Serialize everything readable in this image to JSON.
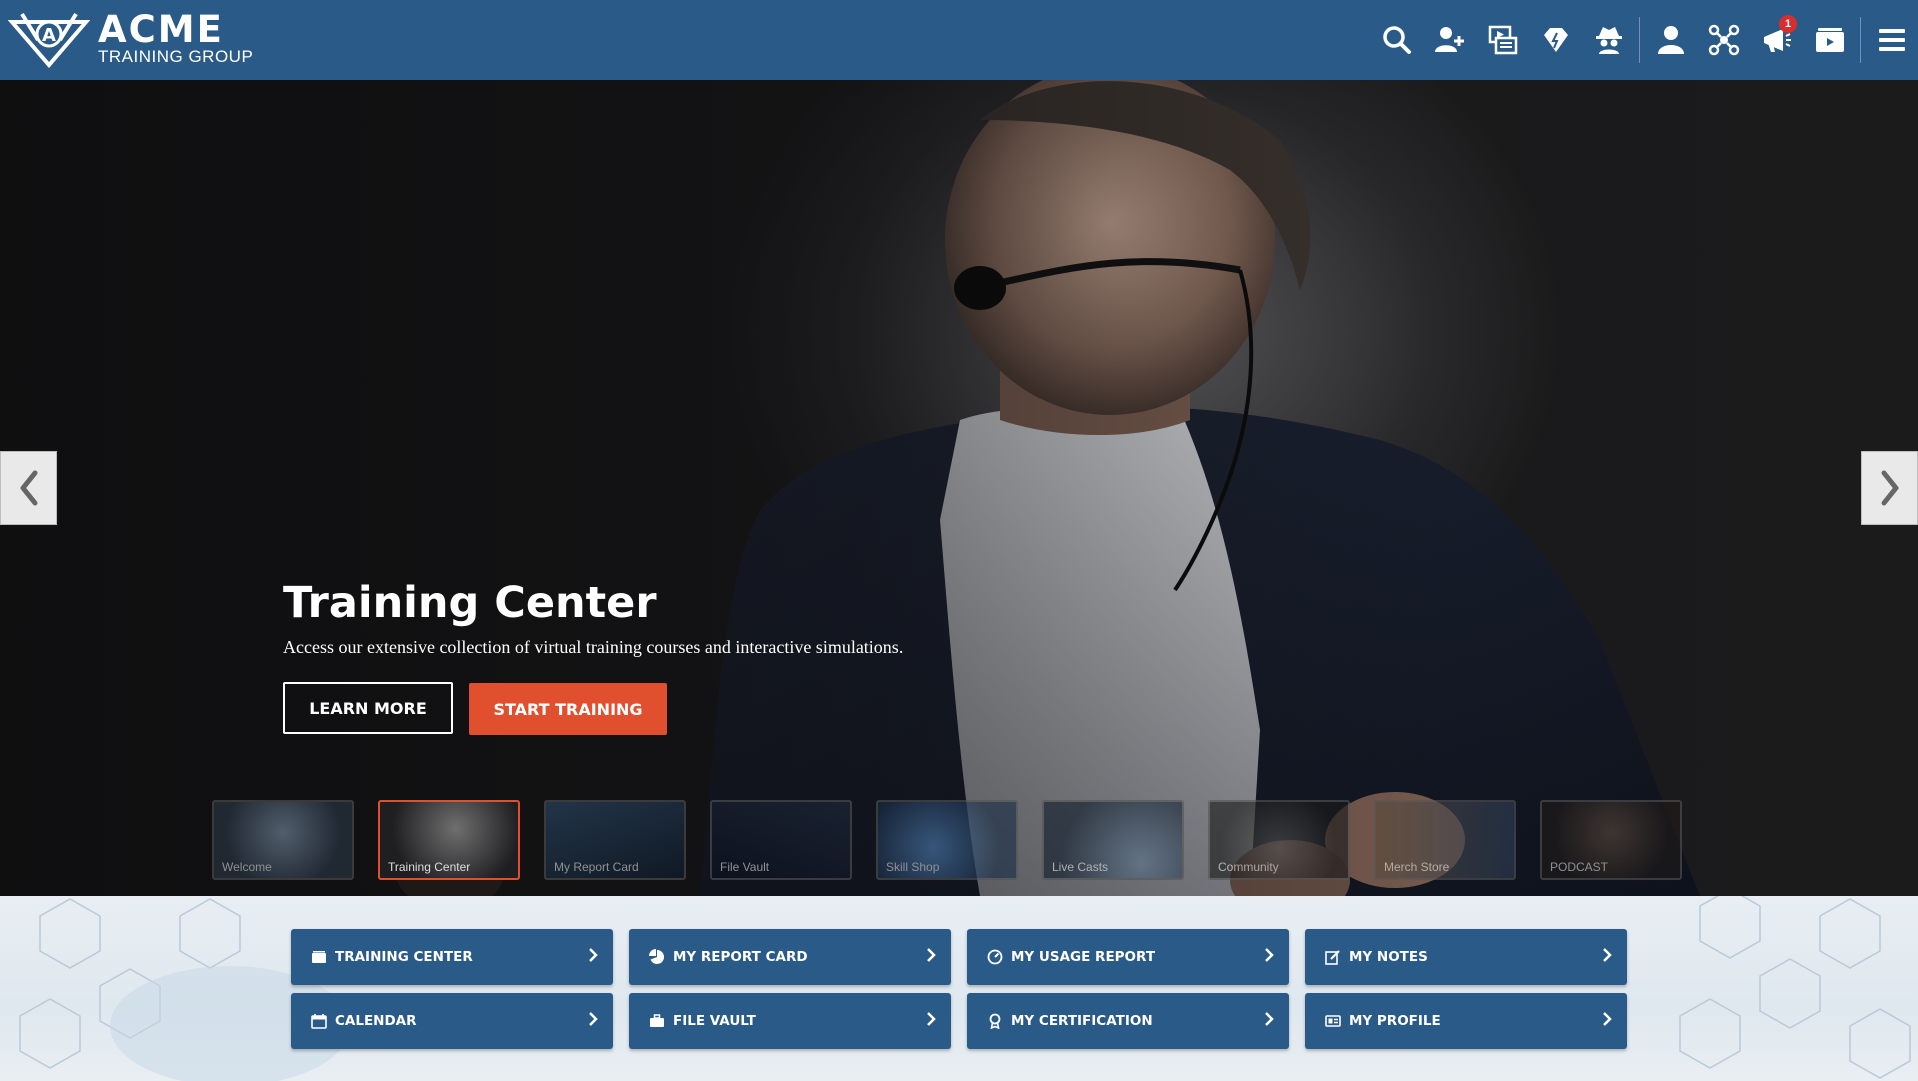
{
  "brand": {
    "title": "ACME",
    "subtitle": "TRAINING GROUP",
    "mark_letter": "A"
  },
  "header_icons": [
    {
      "name": "search-icon"
    },
    {
      "name": "add-user-icon"
    },
    {
      "name": "media-icon"
    },
    {
      "name": "diamond-icon"
    },
    {
      "name": "spy-icon"
    },
    {
      "name": "profile-icon"
    },
    {
      "name": "network-icon"
    },
    {
      "name": "announcement-icon",
      "badge": "1"
    },
    {
      "name": "wallet-icon"
    },
    {
      "name": "menu-icon"
    }
  ],
  "hero": {
    "title": "Training Center",
    "description": "Access our extensive collection of virtual training courses and interactive simulations.",
    "learn_more": "LEARN MORE",
    "start_training": "START TRAINING"
  },
  "thumbnails": [
    {
      "label": "Welcome"
    },
    {
      "label": "Training Center",
      "active": true
    },
    {
      "label": "My Report Card"
    },
    {
      "label": "File Vault"
    },
    {
      "label": "Skill Shop"
    },
    {
      "label": "Live Casts"
    },
    {
      "label": "Community"
    },
    {
      "label": "Merch Store"
    },
    {
      "label": "PODCAST"
    }
  ],
  "quick_links": [
    {
      "label": "TRAINING CENTER",
      "icon": "wallet-icon"
    },
    {
      "label": "MY REPORT CARD",
      "icon": "pie-chart-icon"
    },
    {
      "label": "MY USAGE REPORT",
      "icon": "gauge-icon"
    },
    {
      "label": "MY NOTES",
      "icon": "edit-icon"
    },
    {
      "label": "CALENDAR",
      "icon": "calendar-icon"
    },
    {
      "label": "FILE VAULT",
      "icon": "briefcase-icon"
    },
    {
      "label": "MY CERTIFICATION",
      "icon": "award-icon"
    },
    {
      "label": "MY PROFILE",
      "icon": "id-card-icon"
    }
  ],
  "colors": {
    "primary": "#2a5a87",
    "accent": "#e0502e",
    "badge": "#d92c2c"
  }
}
